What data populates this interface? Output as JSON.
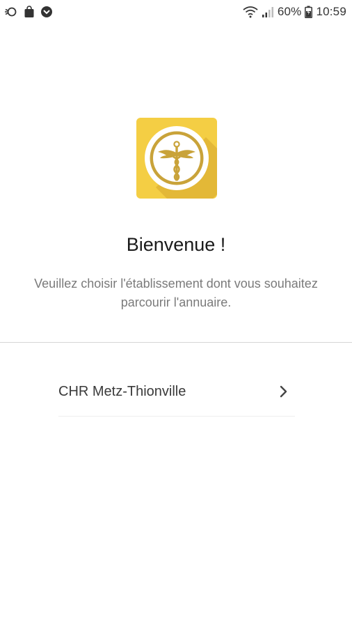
{
  "status_bar": {
    "battery_percent": "60%",
    "time": "10:59",
    "icons": [
      "sync-off-icon",
      "shopping-bag-icon",
      "app-notification-icon",
      "wifi-icon",
      "signal-icon",
      "battery-icon"
    ]
  },
  "app": {
    "logo_icon": "caduceus-icon",
    "brand_color": "#F4CE44",
    "accent_color": "#C9A33A"
  },
  "welcome": {
    "title": "Bienvenue !",
    "subtitle": "Veuillez choisir l'établissement dont vous souhaitez parcourir l'annuaire."
  },
  "establishments": [
    {
      "label": "CHR Metz-Thionville"
    }
  ]
}
